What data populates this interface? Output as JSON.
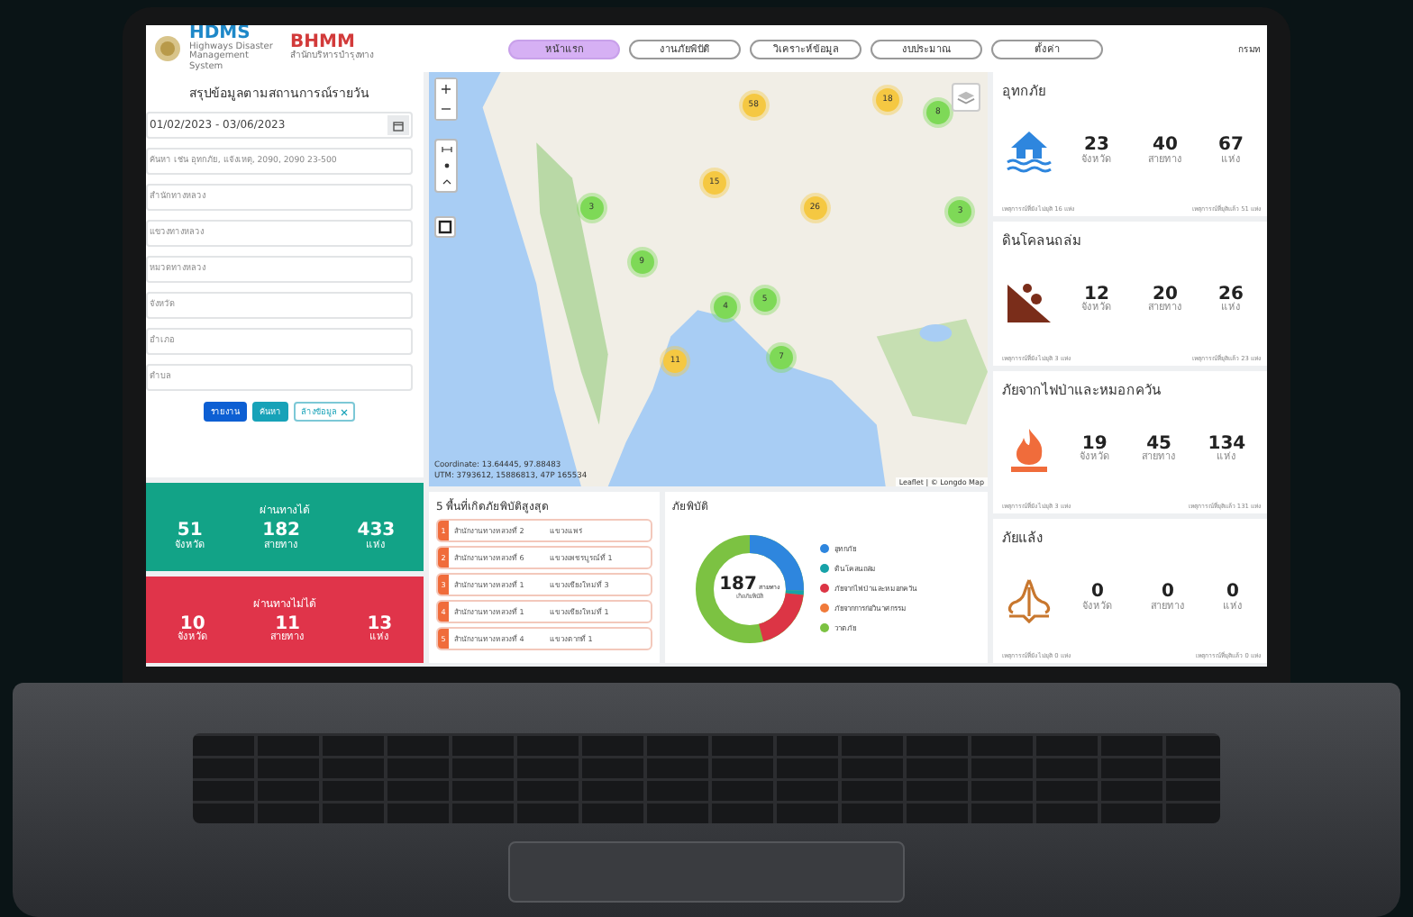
{
  "header": {
    "logo": {
      "title": "HDMS",
      "subtitle": "Highways Disaster Management System"
    },
    "logo2": {
      "title": "BHMM",
      "subtitle": "สำนักบริหารบำรุงทาง"
    },
    "nav": [
      {
        "label": "หน้าแรก",
        "selected": true
      },
      {
        "label": "งานภัยพิบัติ",
        "selected": false
      },
      {
        "label": "วิเคราะห์ข้อมูล",
        "selected": false
      },
      {
        "label": "งบประมาณ",
        "selected": false
      },
      {
        "label": "ตั้งค่า",
        "selected": false
      }
    ],
    "user": "กรมท"
  },
  "filter": {
    "title": "สรุปข้อมูลตามสถานการณ์รายวัน",
    "date_range": "01/02/2023 - 03/06/2023",
    "search_placeholder": "ค้นหา เช่น อุทกภัย, แจ้งเหตุ, 2090, 2090 23-500",
    "fields": [
      {
        "placeholder": "สำนักทางหลวง"
      },
      {
        "placeholder": "แขวงทางหลวง"
      },
      {
        "placeholder": "หมวดทางหลวง"
      },
      {
        "placeholder": "จังหวัด"
      },
      {
        "placeholder": "อำเภอ"
      },
      {
        "placeholder": "ตำบล"
      }
    ],
    "buttons": [
      {
        "label": "รายงาน",
        "kind": "primary"
      },
      {
        "label": "ค้นหา",
        "kind": "info"
      },
      {
        "label": "ล้างข้อมูล",
        "kind": "clear"
      }
    ]
  },
  "status_cards": [
    {
      "kind": "passable",
      "title": "ผ่านทางได้",
      "stats": [
        {
          "value": "51",
          "unit": "จังหวัด"
        },
        {
          "value": "182",
          "unit": "สายทาง"
        },
        {
          "value": "433",
          "unit": "แห่ง"
        }
      ]
    },
    {
      "kind": "blocked",
      "title": "ผ่านทางไม่ได้",
      "stats": [
        {
          "value": "10",
          "unit": "จังหวัด"
        },
        {
          "value": "11",
          "unit": "สายทาง"
        },
        {
          "value": "13",
          "unit": "แห่ง"
        }
      ]
    }
  ],
  "map": {
    "clusters": [
      {
        "count": "58",
        "color": "#f5c842"
      },
      {
        "count": "18",
        "color": "#f5c842"
      },
      {
        "count": "8",
        "color": "#7ed957"
      },
      {
        "count": "15",
        "color": "#f5c842"
      },
      {
        "count": "3",
        "color": "#7ed957"
      },
      {
        "count": "26",
        "color": "#f5c842"
      },
      {
        "count": "3",
        "color": "#7ed957"
      },
      {
        "count": "9",
        "color": "#7ed957"
      },
      {
        "count": "4",
        "color": "#7ed957"
      },
      {
        "count": "5",
        "color": "#7ed957"
      },
      {
        "count": "11",
        "color": "#f5c842"
      },
      {
        "count": "7",
        "color": "#7ed957"
      }
    ],
    "zoom_in": "+",
    "zoom_out": "−",
    "coordinate": "Coordinate: 13.64445, 97.88483",
    "utm": "UTM: 3793612, 15886813, 47P 165534",
    "attribution": "Leaflet | © Longdo Map"
  },
  "top_areas": {
    "title": "5 พื้นที่เกิดภัยพิบัติสูงสุด",
    "rows": [
      {
        "rank": "1",
        "office": "สำนักงานทางหลวงที่ 2",
        "district": "แขวงแพร่"
      },
      {
        "rank": "2",
        "office": "สำนักงานทางหลวงที่ 6",
        "district": "แขวงเพชรบูรณ์ที่ 1"
      },
      {
        "rank": "3",
        "office": "สำนักงานทางหลวงที่ 1",
        "district": "แขวงเชียงใหม่ที่ 3"
      },
      {
        "rank": "4",
        "office": "สำนักงานทางหลวงที่ 1",
        "district": "แขวงเชียงใหม่ที่ 1"
      },
      {
        "rank": "5",
        "office": "สำนักงานทางหลวงที่ 4",
        "district": "แขวงตากที่ 1"
      }
    ]
  },
  "disaster_chart": {
    "title": "ภัยพิบัติ",
    "total": "187",
    "unit": "สายทาง",
    "caption": "เกิดภัยพิบัติ",
    "legend": [
      {
        "label": "อุทกภัย",
        "color": "#2e86de"
      },
      {
        "label": "ดินโคลนถล่ม",
        "color": "#17a2a8"
      },
      {
        "label": "ภัยจากไฟป่าและหมอกควัน",
        "color": "#dc3545"
      },
      {
        "label": "ภัยจากการก่อวินาศกรรม",
        "color": "#f07a3a"
      },
      {
        "label": "วาตภัย",
        "color": "#7cc242"
      }
    ]
  },
  "disasters": [
    {
      "kind": "flood",
      "title": "อุทกภัย",
      "stats": [
        {
          "value": "23",
          "unit": "จังหวัด"
        },
        {
          "value": "40",
          "unit": "สายทาง"
        },
        {
          "value": "67",
          "unit": "แห่ง"
        }
      ],
      "ongoing": "เหตุการณ์ที่ยังไม่ยุติ 16 แห่ง",
      "ended": "เหตุการณ์ที่ยุติแล้ว 51 แห่ง"
    },
    {
      "kind": "landslide",
      "title": "ดินโคลนถล่ม",
      "stats": [
        {
          "value": "12",
          "unit": "จังหวัด"
        },
        {
          "value": "20",
          "unit": "สายทาง"
        },
        {
          "value": "26",
          "unit": "แห่ง"
        }
      ],
      "ongoing": "เหตุการณ์ที่ยังไม่ยุติ 3 แห่ง",
      "ended": "เหตุการณ์ที่ยุติแล้ว 23 แห่ง"
    },
    {
      "kind": "fire",
      "title": "ภัยจากไฟป่าและหมอกควัน",
      "stats": [
        {
          "value": "19",
          "unit": "จังหวัด"
        },
        {
          "value": "45",
          "unit": "สายทาง"
        },
        {
          "value": "134",
          "unit": "แห่ง"
        }
      ],
      "ongoing": "เหตุการณ์ที่ยังไม่ยุติ 3 แห่ง",
      "ended": "เหตุการณ์ที่ยุติแล้ว 131 แห่ง"
    },
    {
      "kind": "drought",
      "title": "ภัยแล้ง",
      "stats": [
        {
          "value": "0",
          "unit": "จังหวัด"
        },
        {
          "value": "0",
          "unit": "สายทาง"
        },
        {
          "value": "0",
          "unit": "แห่ง"
        }
      ],
      "ongoing": "เหตุการณ์ที่ยังไม่ยุติ 0 แห่ง",
      "ended": "เหตุการณ์ที่ยุติแล้ว 0 แห่ง"
    }
  ]
}
